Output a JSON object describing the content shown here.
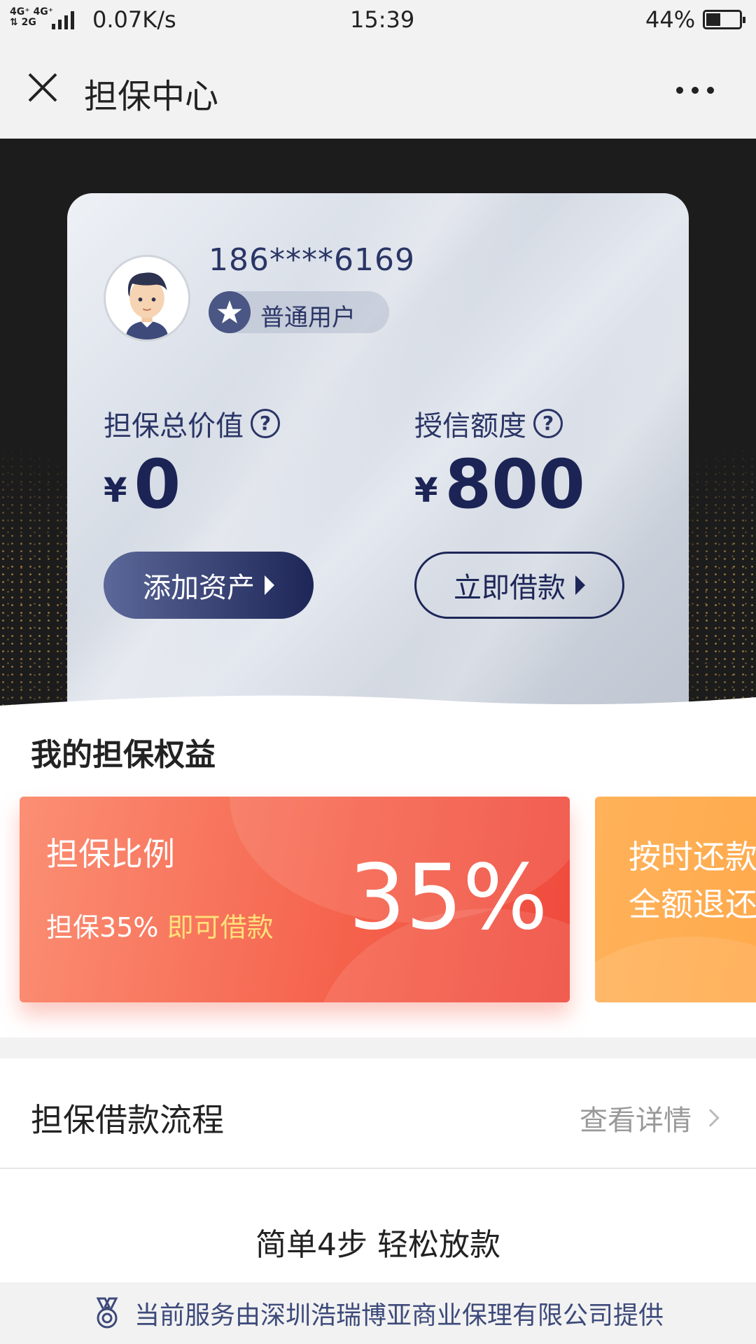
{
  "status_bar": {
    "network_top": "4G⁺ 4G⁺",
    "network_bottom": "⇅ 2G",
    "speed": "0.07K/s",
    "time": "15:39",
    "battery": "44%"
  },
  "nav": {
    "title": "担保中心",
    "close_icon": "close-icon",
    "more_icon": "more-icon"
  },
  "profile": {
    "phone": "186****6169",
    "level": "普通用户"
  },
  "stats": {
    "guarantee_label": "担保总价值",
    "guarantee_currency": "¥",
    "guarantee_value": "0",
    "credit_label": "授信额度",
    "credit_currency": "¥",
    "credit_value": "800",
    "help_glyph": "?"
  },
  "buttons": {
    "add_asset": "添加资产",
    "borrow_now": "立即借款"
  },
  "benefits": {
    "title": "我的担保权益",
    "cards": [
      {
        "title": "担保比例",
        "sub_prefix": "担保35%",
        "sub_highlight": "即可借款",
        "big": "35%"
      },
      {
        "line1": "按时还款",
        "line2": "全额退还"
      }
    ]
  },
  "process": {
    "label": "担保借款流程",
    "link": "查看详情"
  },
  "steps_text": "简单4步 轻松放款",
  "footer": {
    "text": "当前服务由深圳浩瑞博亚商业保理有限公司提供"
  },
  "colors": {
    "navy": "#1d2657",
    "card_red": "#f5624c",
    "card_orange": "#ffa94b",
    "highlight_yellow": "#ffe07a"
  }
}
